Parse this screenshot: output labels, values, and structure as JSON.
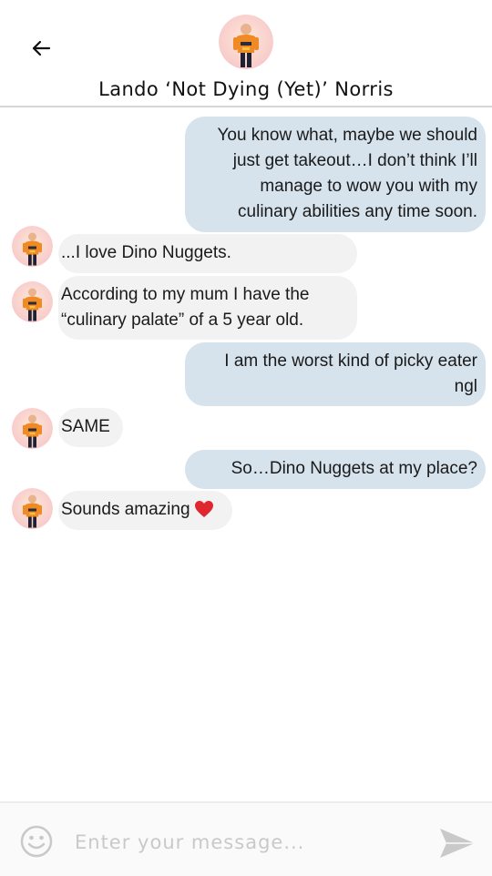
{
  "header": {
    "contact_name": "Lando ‘Not Dying (Yet)’ Norris"
  },
  "messages": [
    {
      "direction": "outgoing",
      "lines": [
        "You know what, maybe we should",
        "just get takeout…I don’t think I’ll",
        "manage to wow you with my",
        "culinary abilities any time soon."
      ]
    },
    {
      "direction": "incoming",
      "lines": [
        "...I love Dino Nuggets."
      ]
    },
    {
      "direction": "incoming",
      "lines": [
        "According to my mum I have the",
        "“culinary palate” of a 5 year old."
      ]
    },
    {
      "direction": "outgoing",
      "lines": [
        "I am the worst kind of picky eater",
        "ngl"
      ]
    },
    {
      "direction": "incoming",
      "lines": [
        "SAME"
      ]
    },
    {
      "direction": "outgoing",
      "lines": [
        "So…Dino Nuggets at my place?"
      ]
    },
    {
      "direction": "incoming",
      "lines": [
        "Sounds amazing"
      ],
      "trailing_icon": "red-heart-icon"
    }
  ],
  "composer": {
    "placeholder": "Enter your message...",
    "value": ""
  },
  "colors": {
    "outgoing_bubble": "#d6e2ec",
    "incoming_bubble": "#f2f2f2",
    "heart": "#e0262f",
    "icon_gray": "#c9c9c9"
  },
  "icons": {
    "back": "arrow-left-icon",
    "emoji": "smiley-face-icon",
    "send": "send-arrow-icon",
    "avatar": "contact-avatar"
  }
}
